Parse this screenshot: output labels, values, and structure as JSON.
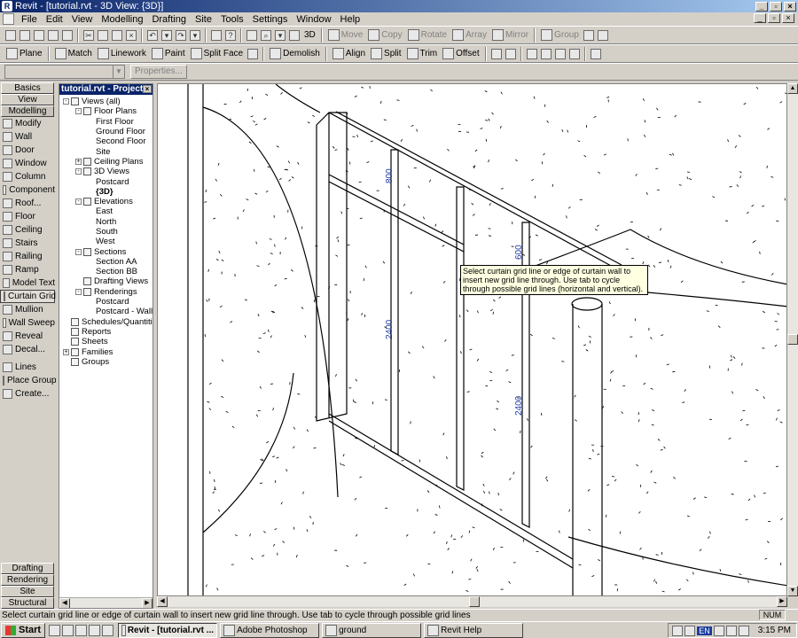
{
  "window": {
    "title": "Revit - [tutorial.rvt - 3D View: {3D}]",
    "app_icon": "R"
  },
  "menu": [
    "File",
    "Edit",
    "View",
    "Modelling",
    "Drafting",
    "Site",
    "Tools",
    "Settings",
    "Window",
    "Help"
  ],
  "toolbar1": {
    "three_d": "3D",
    "move": "Move",
    "copy": "Copy",
    "rotate": "Rotate",
    "array": "Array",
    "mirror": "Mirror",
    "group": "Group"
  },
  "toolbar2": {
    "plane": "Plane",
    "match": "Match",
    "linework": "Linework",
    "paint": "Paint",
    "split_face": "Split Face",
    "demolish": "Demolish",
    "align": "Align",
    "split": "Split",
    "trim": "Trim",
    "offset": "Offset"
  },
  "toolbar3": {
    "type_selector_value": "",
    "properties": "Properties..."
  },
  "design_bar": {
    "tabs_top": [
      "Basics",
      "View",
      "Modelling"
    ],
    "items": [
      {
        "label": "Modify",
        "icon": "arrow-icon"
      },
      {
        "label": "Wall",
        "icon": "wall-icon"
      },
      {
        "label": "Door",
        "icon": "door-icon"
      },
      {
        "label": "Window",
        "icon": "window-icon"
      },
      {
        "label": "Column",
        "icon": "column-icon"
      },
      {
        "label": "Component",
        "icon": "component-icon"
      },
      {
        "label": "Roof...",
        "icon": "roof-icon"
      },
      {
        "label": "Floor",
        "icon": "floor-icon"
      },
      {
        "label": "Ceiling",
        "icon": "ceiling-icon"
      },
      {
        "label": "Stairs",
        "icon": "stairs-icon"
      },
      {
        "label": "Railing",
        "icon": "railing-icon"
      },
      {
        "label": "Ramp",
        "icon": "ramp-icon"
      },
      {
        "label": "Model Text",
        "icon": "text-icon"
      },
      {
        "label": "Curtain Grid",
        "icon": "curtain-grid-icon"
      },
      {
        "label": "Mullion",
        "icon": "mullion-icon"
      },
      {
        "label": "Wall Sweep",
        "icon": "wall-sweep-icon"
      },
      {
        "label": "Reveal",
        "icon": "reveal-icon"
      },
      {
        "label": "Decal...",
        "icon": "decal-icon"
      },
      {
        "label": "Lines",
        "icon": "lines-icon"
      },
      {
        "label": "Place Group",
        "icon": "group-icon"
      },
      {
        "label": "Create...",
        "icon": "create-icon"
      }
    ],
    "tabs_bottom": [
      "Drafting",
      "Rendering",
      "Site",
      "Structural"
    ]
  },
  "project_browser": {
    "title": "tutorial.rvt - Project ...",
    "tree": [
      {
        "label": "Views (all)",
        "level": 0,
        "toggle": "-"
      },
      {
        "label": "Floor Plans",
        "level": 1,
        "toggle": "-"
      },
      {
        "label": "First Floor",
        "level": 2
      },
      {
        "label": "Ground Floor",
        "level": 2
      },
      {
        "label": "Second Floor",
        "level": 2
      },
      {
        "label": "Site",
        "level": 2
      },
      {
        "label": "Ceiling Plans",
        "level": 1,
        "toggle": "+"
      },
      {
        "label": "3D Views",
        "level": 1,
        "toggle": "-"
      },
      {
        "label": "Postcard",
        "level": 2
      },
      {
        "label": "{3D}",
        "level": 2,
        "bold": true
      },
      {
        "label": "Elevations",
        "level": 1,
        "toggle": "-"
      },
      {
        "label": "East",
        "level": 2
      },
      {
        "label": "North",
        "level": 2
      },
      {
        "label": "South",
        "level": 2
      },
      {
        "label": "West",
        "level": 2
      },
      {
        "label": "Sections",
        "level": 1,
        "toggle": "-"
      },
      {
        "label": "Section AA",
        "level": 2
      },
      {
        "label": "Section BB",
        "level": 2
      },
      {
        "label": "Drafting Views",
        "level": 1
      },
      {
        "label": "Renderings",
        "level": 1,
        "toggle": "-"
      },
      {
        "label": "Postcard",
        "level": 2
      },
      {
        "label": "Postcard - Wall",
        "level": 2
      },
      {
        "label": "Schedules/Quantities",
        "level": 0
      },
      {
        "label": "Reports",
        "level": 0
      },
      {
        "label": "Sheets",
        "level": 0
      },
      {
        "label": "Families",
        "level": 0,
        "toggle": "+"
      },
      {
        "label": "Groups",
        "level": 0
      }
    ]
  },
  "canvas": {
    "dimensions": [
      "800",
      "2400",
      "600",
      "2400"
    ],
    "tooltip": "Select curtain grid line or edge of curtain wall to insert new grid line through.  Use tab to cycle through possible grid lines (horizontal and vertical)."
  },
  "status": {
    "message": "Select curtain grid line or edge of curtain wall to insert new grid line through.  Use tab to cycle through possible grid lines",
    "num": "NUM"
  },
  "taskbar": {
    "start": "Start",
    "tasks": [
      {
        "label": "Revit - [tutorial.rvt ...",
        "active": true
      },
      {
        "label": "Adobe Photoshop",
        "active": false
      },
      {
        "label": "ground",
        "active": false
      },
      {
        "label": "Revit Help",
        "active": false
      }
    ],
    "lang": "EN",
    "clock": "3:15 PM"
  }
}
